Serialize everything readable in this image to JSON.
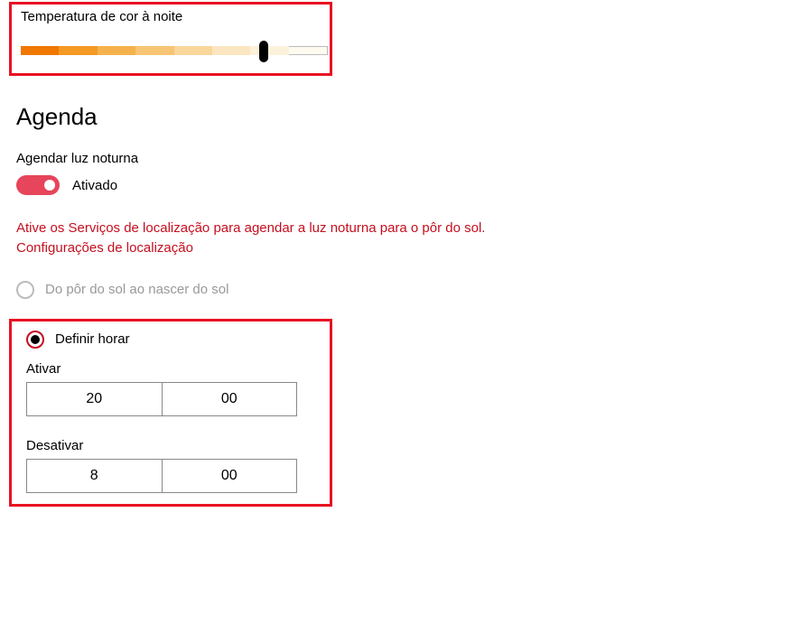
{
  "colorTemp": {
    "label": "Temperatura de cor à noite",
    "sliderPositionPct": 78
  },
  "agenda": {
    "heading": "Agenda",
    "scheduleLabel": "Agendar luz noturna",
    "toggleState": "Ativado",
    "warning": "Ative os Serviços de localização para agendar a luz noturna para o pôr do sol.",
    "locationLink": "Configurações de localização",
    "options": {
      "sunsetSunrise": "Do pôr do sol ao nascer do sol",
      "setHours": "Definir horar"
    },
    "activate": {
      "label": "Ativar",
      "hour": "20",
      "minute": "00"
    },
    "deactivate": {
      "label": "Desativar",
      "hour": "8",
      "minute": "00"
    }
  }
}
